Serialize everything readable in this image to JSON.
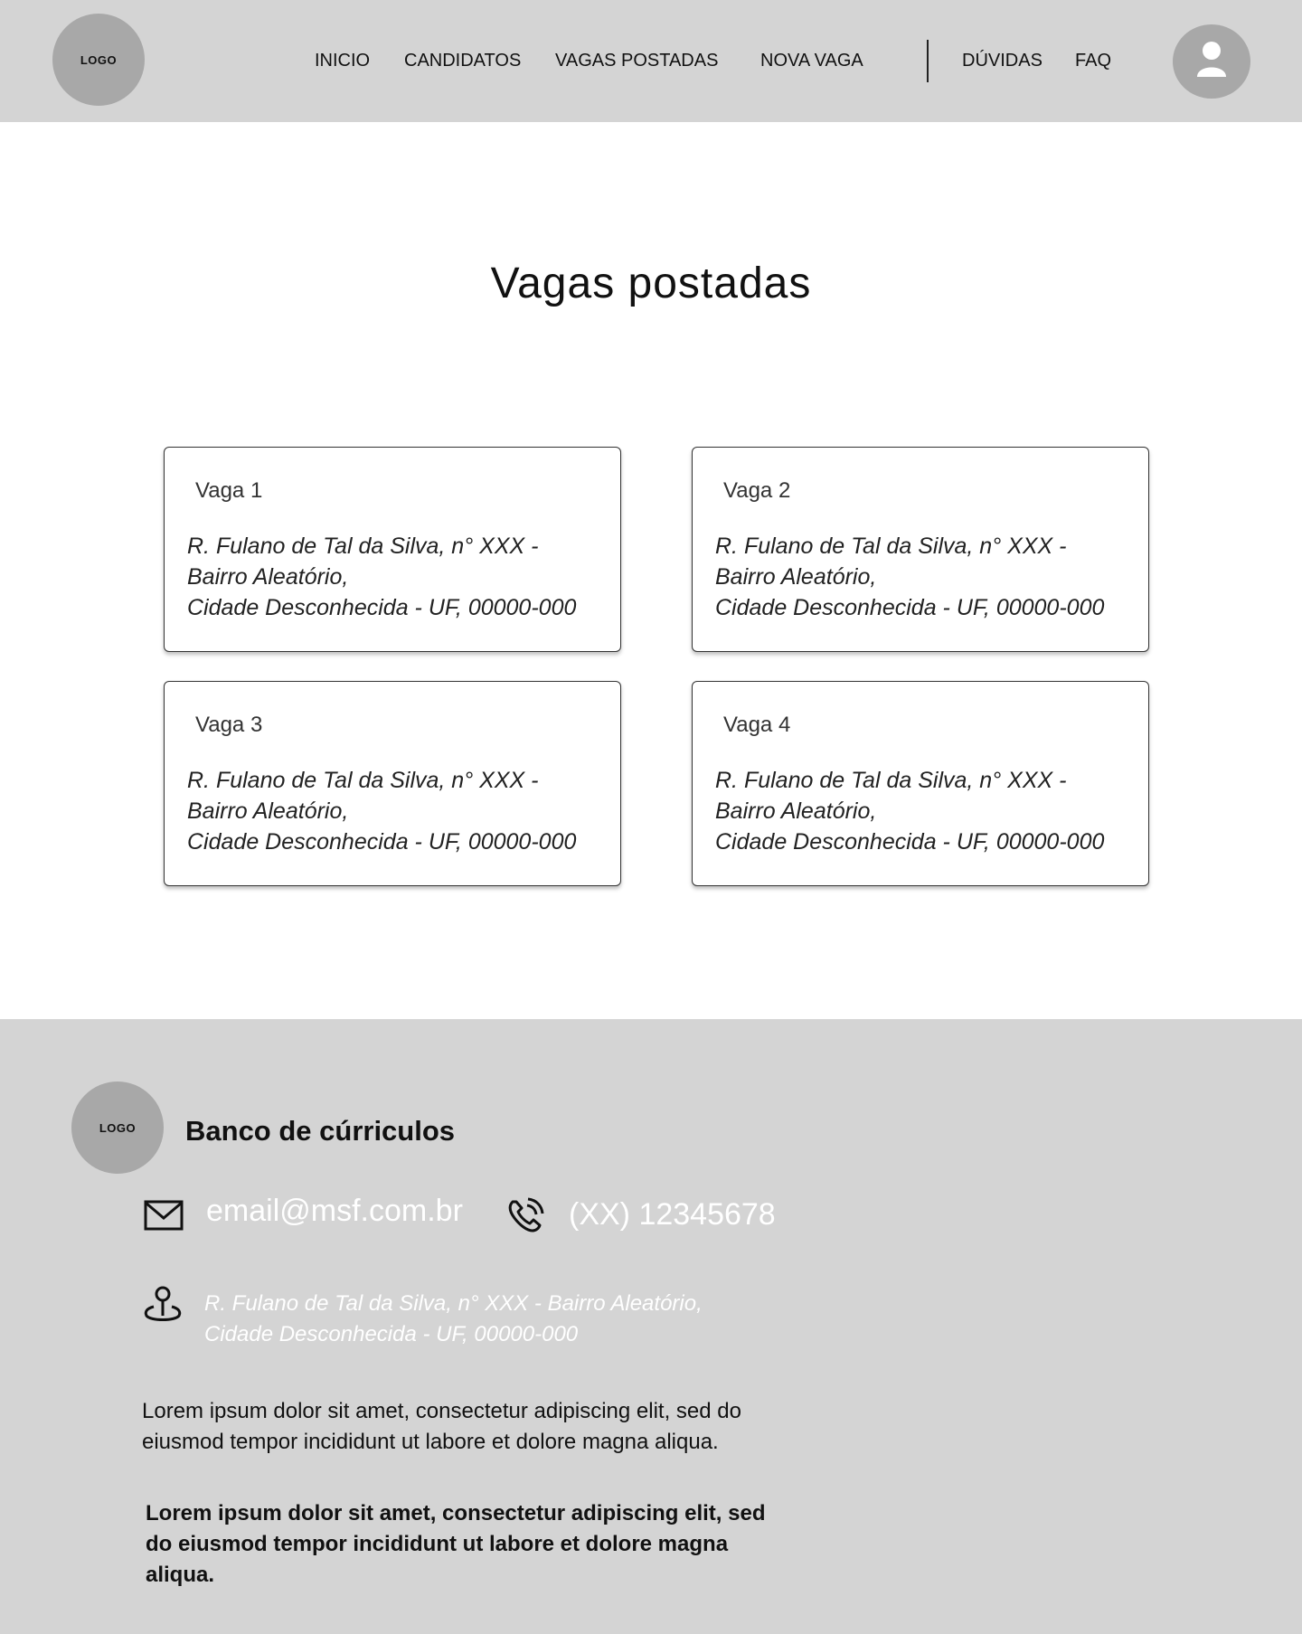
{
  "header": {
    "logo": "LOGO",
    "nav": [
      {
        "label": "INICIO"
      },
      {
        "label": "CANDIDATOS"
      },
      {
        "label": "VAGAS POSTADAS"
      },
      {
        "label": "NOVA VAGA"
      },
      {
        "label": "DÚVIDAS"
      },
      {
        "label": "FAQ"
      }
    ],
    "avatar_icon": "user-icon"
  },
  "main": {
    "title": "Vagas postadas",
    "cards": [
      {
        "title": "Vaga 1",
        "address": [
          "R. Fulano de Tal da Silva, n° XXX -",
          "Bairro Aleatório,",
          "Cidade Desconhecida - UF, 00000-000"
        ]
      },
      {
        "title": "Vaga 2",
        "address": [
          "R. Fulano de Tal da Silva, n° XXX -",
          "Bairro Aleatório,",
          "Cidade Desconhecida - UF, 00000-000"
        ]
      },
      {
        "title": "Vaga 3",
        "address": [
          "R. Fulano de Tal da Silva, n° XXX -",
          "Bairro Aleatório,",
          "Cidade Desconhecida - UF, 00000-000"
        ]
      },
      {
        "title": "Vaga 4",
        "address": [
          "R. Fulano de Tal da Silva, n° XXX -",
          "Bairro Aleatório,",
          "Cidade Desconhecida - UF, 00000-000"
        ]
      }
    ]
  },
  "footer": {
    "logo": "LOGO",
    "brand": "Banco de cúrriculos",
    "email": "email@msf.com.br",
    "phone": "(XX) 12345678",
    "address": [
      "R. Fulano de Tal da Silva, n° XXX - Bairro Aleatório,",
      "Cidade Desconhecida - UF, 00000-000"
    ],
    "paragraph": "Lorem ipsum dolor sit amet, consectetur adipiscing elit, sed do eiusmod tempor incididunt ut labore et dolore magna aliqua.",
    "paragraph_bold": "Lorem ipsum dolor sit amet, consectetur adipiscing elit, sed do eiusmod tempor incididunt ut labore et dolore magna aliqua.",
    "icons": [
      "mail-icon",
      "phone-icon",
      "location-pin-icon"
    ]
  },
  "colors": {
    "bar_background": "#d4d4d4",
    "placeholder_gray": "#a8a8a8",
    "contact_text": "#ffffff"
  }
}
